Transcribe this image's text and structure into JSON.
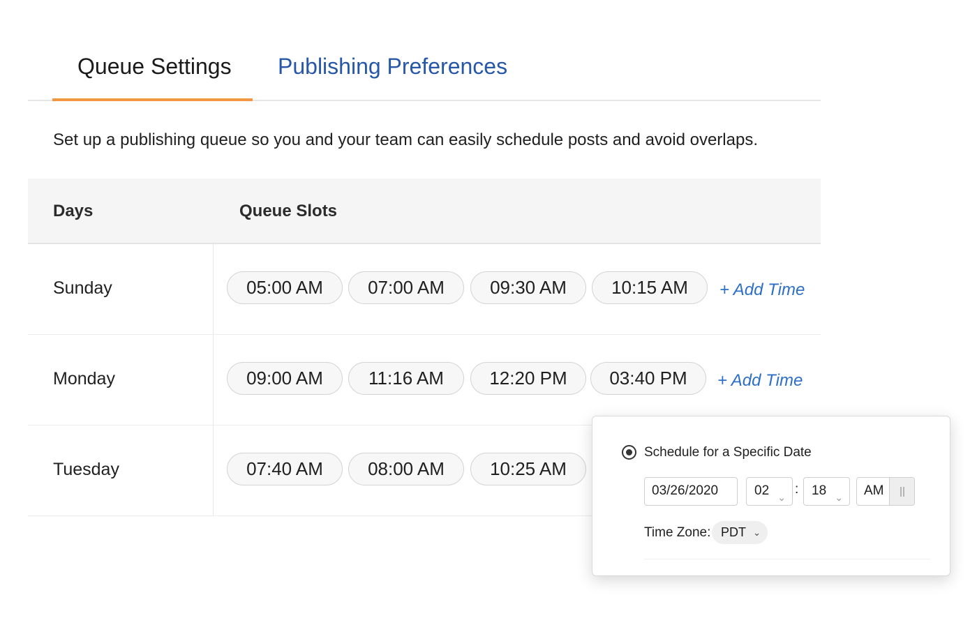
{
  "tabs": [
    {
      "label": "Queue Settings",
      "active": true
    },
    {
      "label": "Publishing Preferences",
      "active": false
    }
  ],
  "description": "Set up a publishing queue so you and your team can easily schedule posts and avoid overlaps.",
  "table": {
    "headers": {
      "days": "Days",
      "slots": "Queue Slots"
    },
    "rows": [
      {
        "day": "Sunday",
        "slots": [
          "05:00 AM",
          "07:00 AM",
          "09:30 AM",
          "10:15 AM"
        ]
      },
      {
        "day": "Monday",
        "slots": [
          "09:00 AM",
          "11:16 AM",
          "12:20 PM",
          "03:40 PM"
        ]
      },
      {
        "day": "Tuesday",
        "slots": [
          "07:40 AM",
          "08:00 AM",
          "10:25 AM"
        ]
      }
    ],
    "add_time_label": "+ Add Time"
  },
  "schedule_popup": {
    "option_label": "Schedule for a Specific Date",
    "date": "03/26/2020",
    "hour": "02",
    "separator": ":",
    "minute": "18",
    "meridiem": "AM",
    "timezone_label": "Time Zone:",
    "timezone": "PDT"
  },
  "colors": {
    "accent_orange": "#f29642",
    "link_blue": "#2d6fc8",
    "tab_blue": "#2757a8"
  }
}
